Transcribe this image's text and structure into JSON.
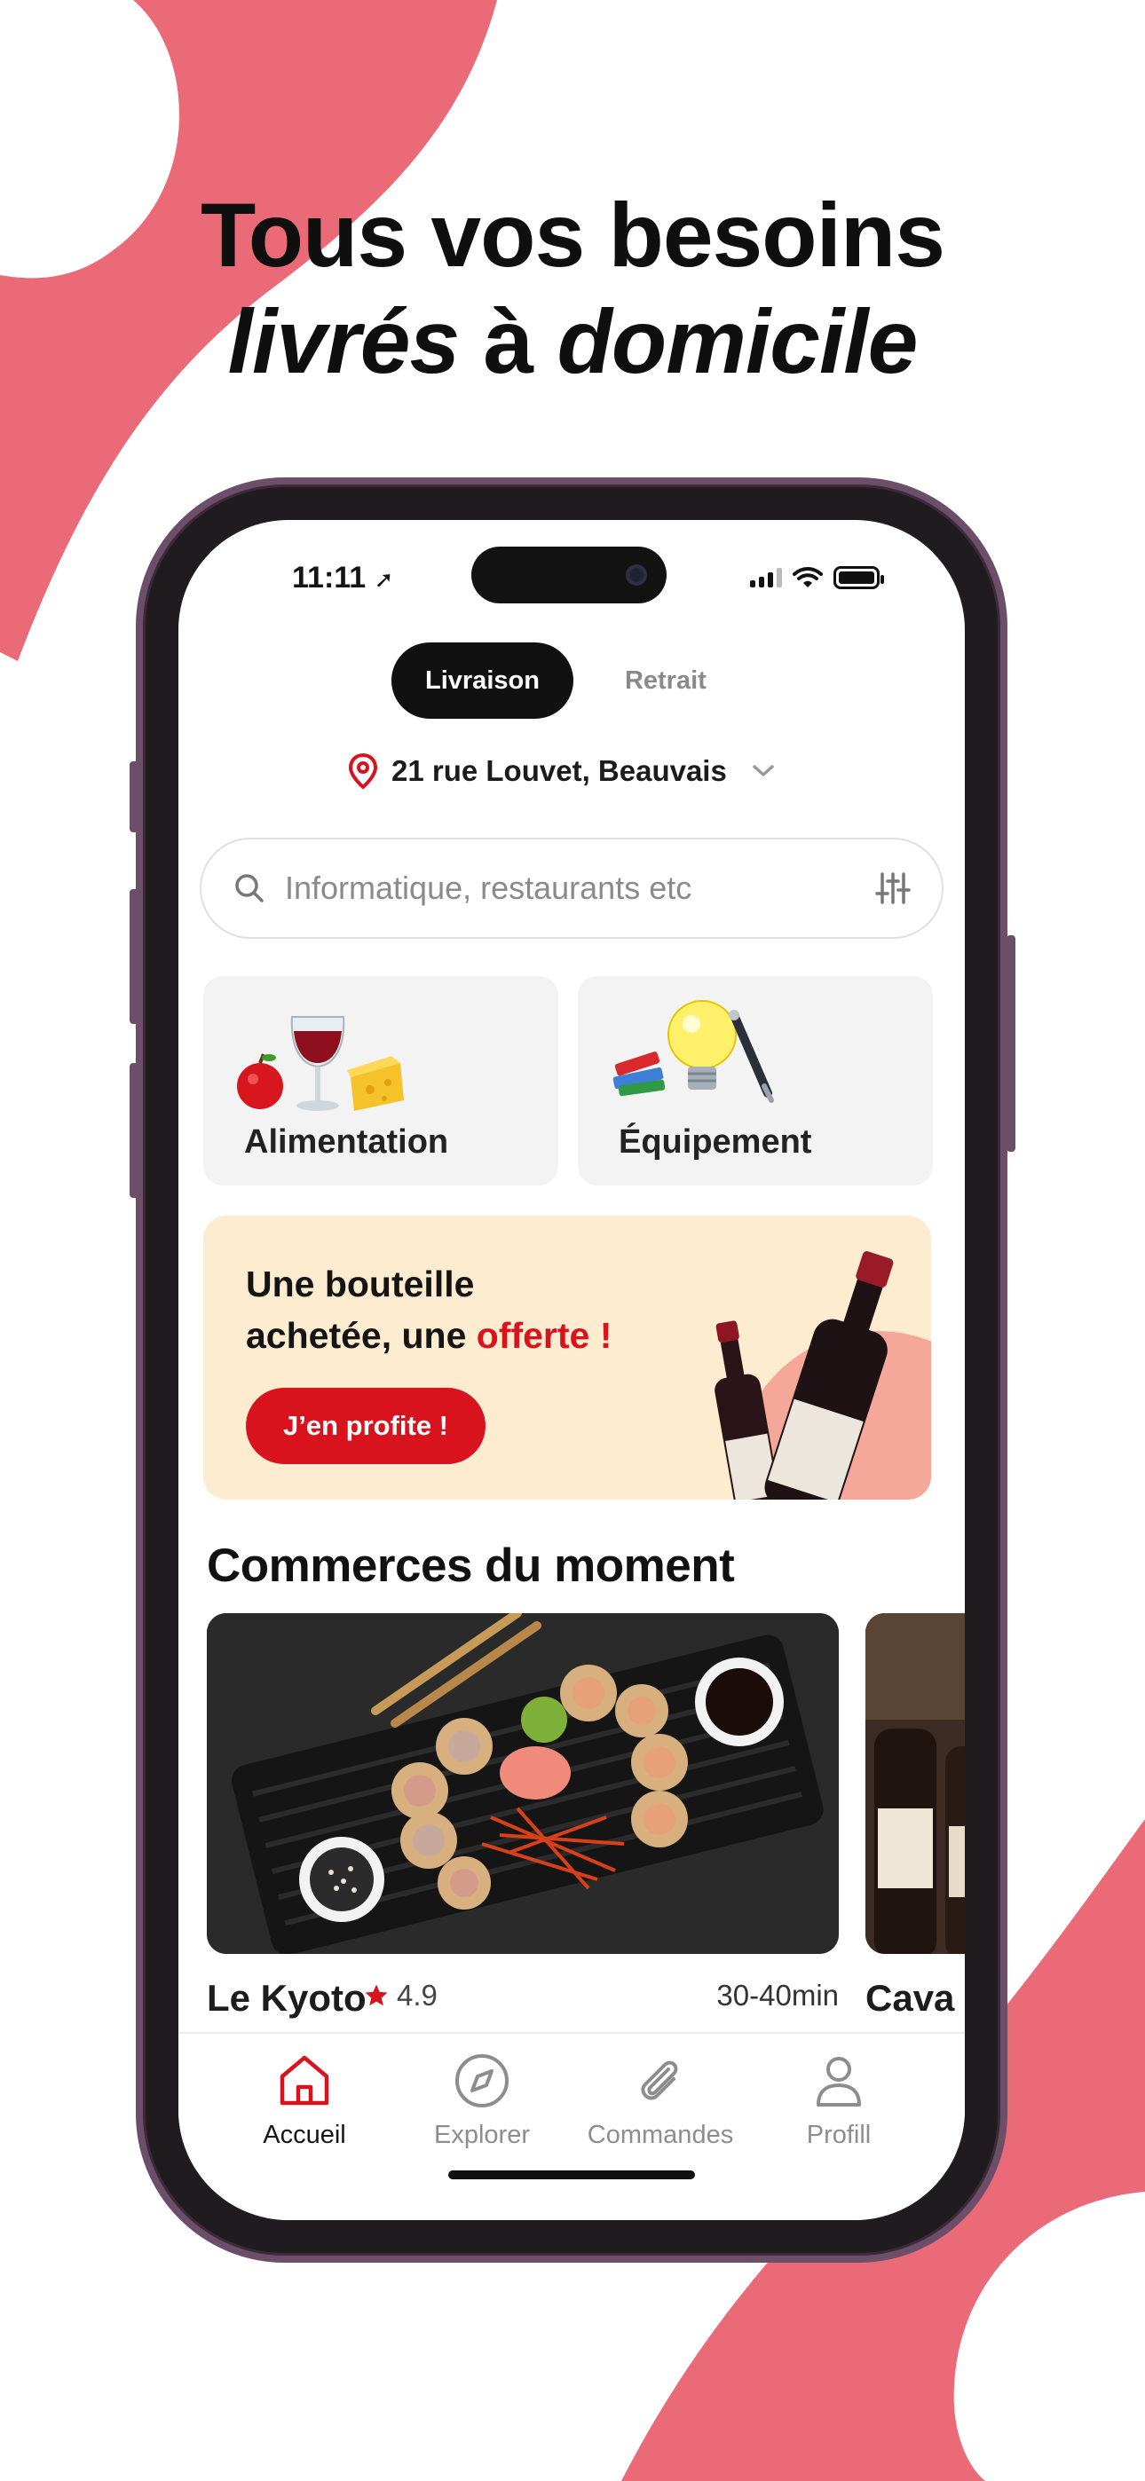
{
  "colors": {
    "brand": "#EB6A77",
    "accent_red": "#D9131E",
    "promo_bg": "#FDECD0",
    "dark": "#111111"
  },
  "headline": {
    "line1": "Tous vos besoins",
    "line2_a": "livrés",
    "line2_b": " à ",
    "line2_c": "domicile"
  },
  "status_bar": {
    "time": "11:11"
  },
  "mode_toggle": {
    "options": [
      "Livraison",
      "Retrait"
    ],
    "selected": "Livraison"
  },
  "address": {
    "text": "21 rue Louvet, Beauvais",
    "icon": "location-pin-icon"
  },
  "search": {
    "placeholder": "Informatique, restaurants etc",
    "icon": "search-icon",
    "filter_icon": "sliders-icon"
  },
  "categories": [
    {
      "label": "Alimentation",
      "icon": "food-wine-cheese-icon"
    },
    {
      "label": "Équipement",
      "icon": "books-bulb-pen-icon"
    }
  ],
  "promo": {
    "line1": "Une bouteille",
    "line2_a": "achetée, une ",
    "line2_b": "offerte !",
    "button": "J’en profite !"
  },
  "section": {
    "title": "Commerces du moment"
  },
  "shops": [
    {
      "name": "Le Kyoto",
      "rating": "4.9",
      "time": "30-40min",
      "image": "sushi-plate-image"
    },
    {
      "name": "Cava",
      "image": "wine-bottles-image"
    }
  ],
  "tabbar": {
    "items": [
      {
        "label": "Accueil",
        "icon": "home-icon",
        "active": true
      },
      {
        "label": "Explorer",
        "icon": "compass-icon",
        "active": false
      },
      {
        "label": "Commandes",
        "icon": "paperclip-icon",
        "active": false
      },
      {
        "label": "Profill",
        "icon": "user-icon",
        "active": false
      }
    ]
  }
}
